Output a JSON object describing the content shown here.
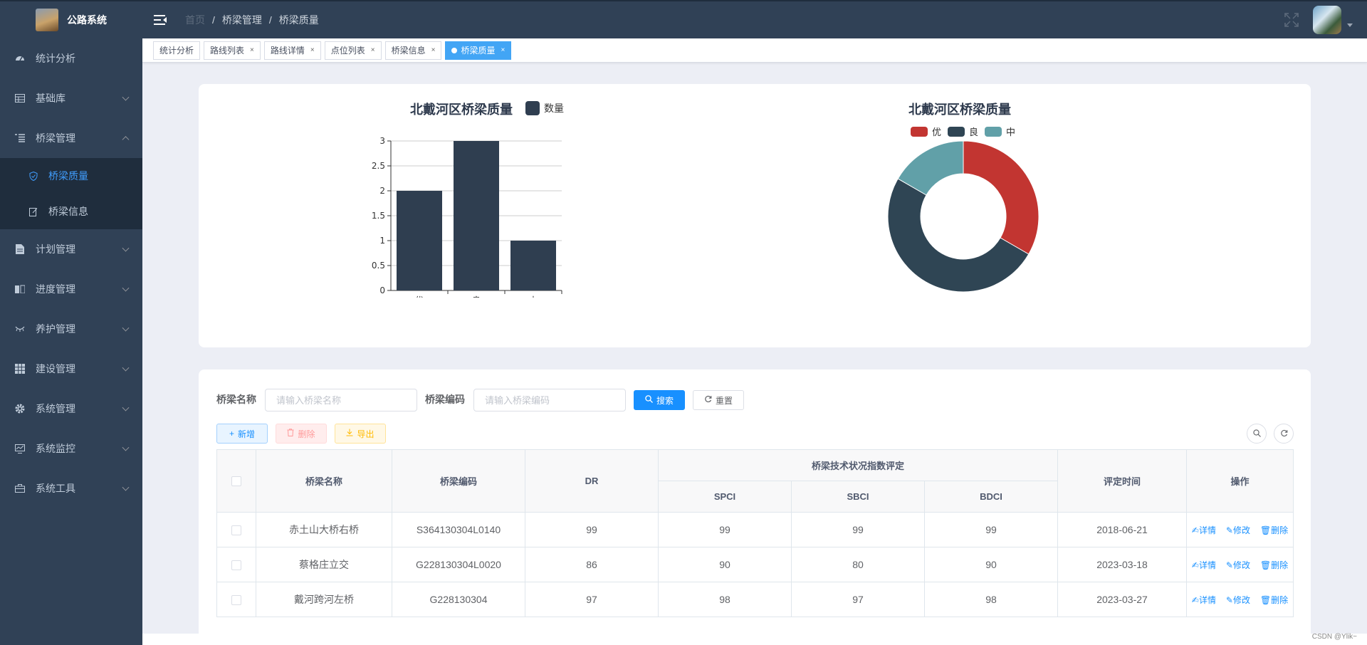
{
  "app": {
    "title": "公路系统"
  },
  "sidebar": {
    "items": [
      {
        "label": "统计分析",
        "icon": "dashboard-icon"
      },
      {
        "label": "基础库",
        "icon": "table-icon"
      },
      {
        "label": "桥梁管理",
        "icon": "tree-table-icon",
        "expanded": true,
        "children": [
          {
            "label": "桥梁质量",
            "icon": "shield-check-icon",
            "active": true
          },
          {
            "label": "桥梁信息",
            "icon": "edit-doc-icon"
          }
        ]
      },
      {
        "label": "计划管理",
        "icon": "document-icon"
      },
      {
        "label": "进度管理",
        "icon": "book-icon"
      },
      {
        "label": "养护管理",
        "icon": "eye-closed-icon"
      },
      {
        "label": "建设管理",
        "icon": "grid-icon"
      },
      {
        "label": "系统管理",
        "icon": "gear-icon"
      },
      {
        "label": "系统监控",
        "icon": "monitor-icon"
      },
      {
        "label": "系统工具",
        "icon": "toolbox-icon"
      }
    ]
  },
  "navbar": {
    "breadcrumb": [
      "首页",
      "桥梁管理",
      "桥梁质量"
    ],
    "separator": "/"
  },
  "tags": [
    {
      "label": "统计分析",
      "closable": false
    },
    {
      "label": "路线列表",
      "closable": true
    },
    {
      "label": "路线详情",
      "closable": true
    },
    {
      "label": "点位列表",
      "closable": true
    },
    {
      "label": "桥梁信息",
      "closable": true
    },
    {
      "label": "桥梁质量",
      "closable": true,
      "active": true
    }
  ],
  "close_glyph": "×",
  "chart_data": [
    {
      "type": "bar",
      "title": "北戴河区桥梁质量",
      "categories": [
        "优",
        "良",
        "中"
      ],
      "series": [
        {
          "name": "数量",
          "values": [
            2,
            3,
            1
          ]
        }
      ],
      "ylim": [
        0,
        3
      ],
      "yticks": [
        "0",
        "0.5",
        "1",
        "1.5",
        "2",
        "2.5",
        "3"
      ],
      "color": "#2f3e50",
      "legend": "top-right"
    },
    {
      "type": "pie",
      "title": "北戴河区桥梁质量",
      "labels": [
        "优",
        "良",
        "中"
      ],
      "values": [
        2,
        3,
        1
      ],
      "colors": [
        "#c23531",
        "#2f4554",
        "#61a0a8"
      ],
      "donut": true,
      "legend": "top"
    }
  ],
  "search": {
    "name_label": "桥梁名称",
    "name_placeholder": "请输入桥梁名称",
    "code_label": "桥梁编码",
    "code_placeholder": "请输入桥梁编码",
    "search_button": "搜索",
    "reset_button": "重置"
  },
  "toolbar": {
    "add": "新增",
    "delete": "删除",
    "export": "导出"
  },
  "table": {
    "headers": {
      "name": "桥梁名称",
      "code": "桥梁编码",
      "dr": "DR",
      "group": "桥梁技术状况指数评定",
      "spci": "SPCI",
      "sbci": "SBCI",
      "bdci": "BDCI",
      "time": "评定时间",
      "ops": "操作"
    },
    "rows": [
      {
        "name": "赤土山大桥右桥",
        "code": "S364130304L0140",
        "dr": "99",
        "spci": "99",
        "sbci": "99",
        "bdci": "99",
        "time": "2018-06-21"
      },
      {
        "name": "蔡格庄立交",
        "code": "G228130304L0020",
        "dr": "86",
        "spci": "90",
        "sbci": "80",
        "bdci": "90",
        "time": "2023-03-18"
      },
      {
        "name": "戴河跨河左桥",
        "code": "G228130304",
        "dr": "97",
        "spci": "98",
        "sbci": "97",
        "bdci": "98",
        "time": "2023-03-27"
      }
    ],
    "op_labels": {
      "detail": "详情",
      "edit": "修改",
      "delete": "删除"
    }
  },
  "watermark": "CSDN @Ylik~"
}
